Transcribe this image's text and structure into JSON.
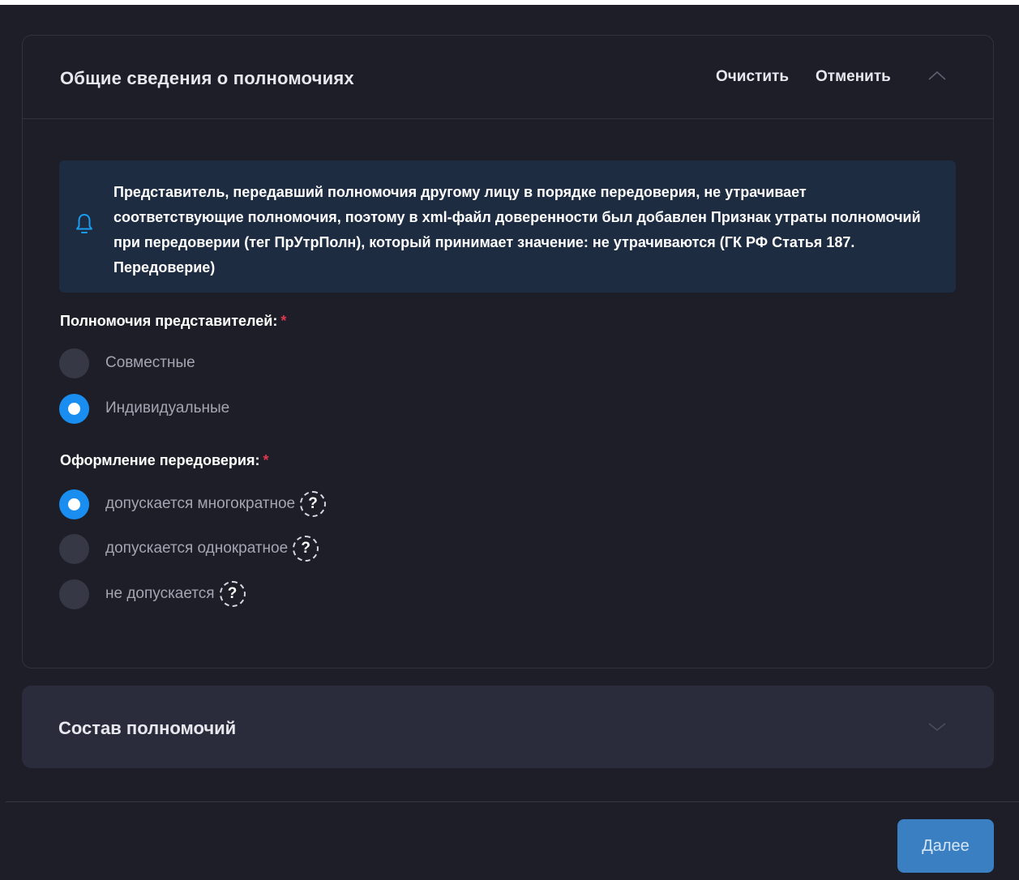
{
  "section1": {
    "title": "Общие сведения о полномочиях",
    "clear_label": "Очистить",
    "cancel_label": "Отменить",
    "info_text": "Представитель, передавший полномочия другому лицу в порядке передоверия, не утрачивает соответствующие полномочия, поэтому в xml-файл доверенности был добавлен Признак утраты полномочий при передоверии (тег ПрУтрПолн), который принимает значение: не утрачиваются (ГК РФ Статья 187. Передоверие)",
    "group1": {
      "label": "Полномочия представителей:",
      "required": "*",
      "options": [
        {
          "label": "Совместные",
          "checked": false
        },
        {
          "label": "Индивидуальные",
          "checked": true
        }
      ]
    },
    "group2": {
      "label": "Оформление передоверия:",
      "required": "*",
      "options": [
        {
          "label": "допускается многократное",
          "checked": true
        },
        {
          "label": "допускается однократное",
          "checked": false
        },
        {
          "label": "не допускается",
          "checked": false
        }
      ],
      "help_glyph": "?"
    }
  },
  "section2": {
    "title": "Состав полномочий"
  },
  "footer": {
    "next_label": "Далее"
  },
  "colors": {
    "background": "#1d1e27",
    "accent": "#1a8ef0",
    "info_bg": "#1d2c41",
    "button": "#3a7fc2",
    "required": "#e0364c"
  }
}
